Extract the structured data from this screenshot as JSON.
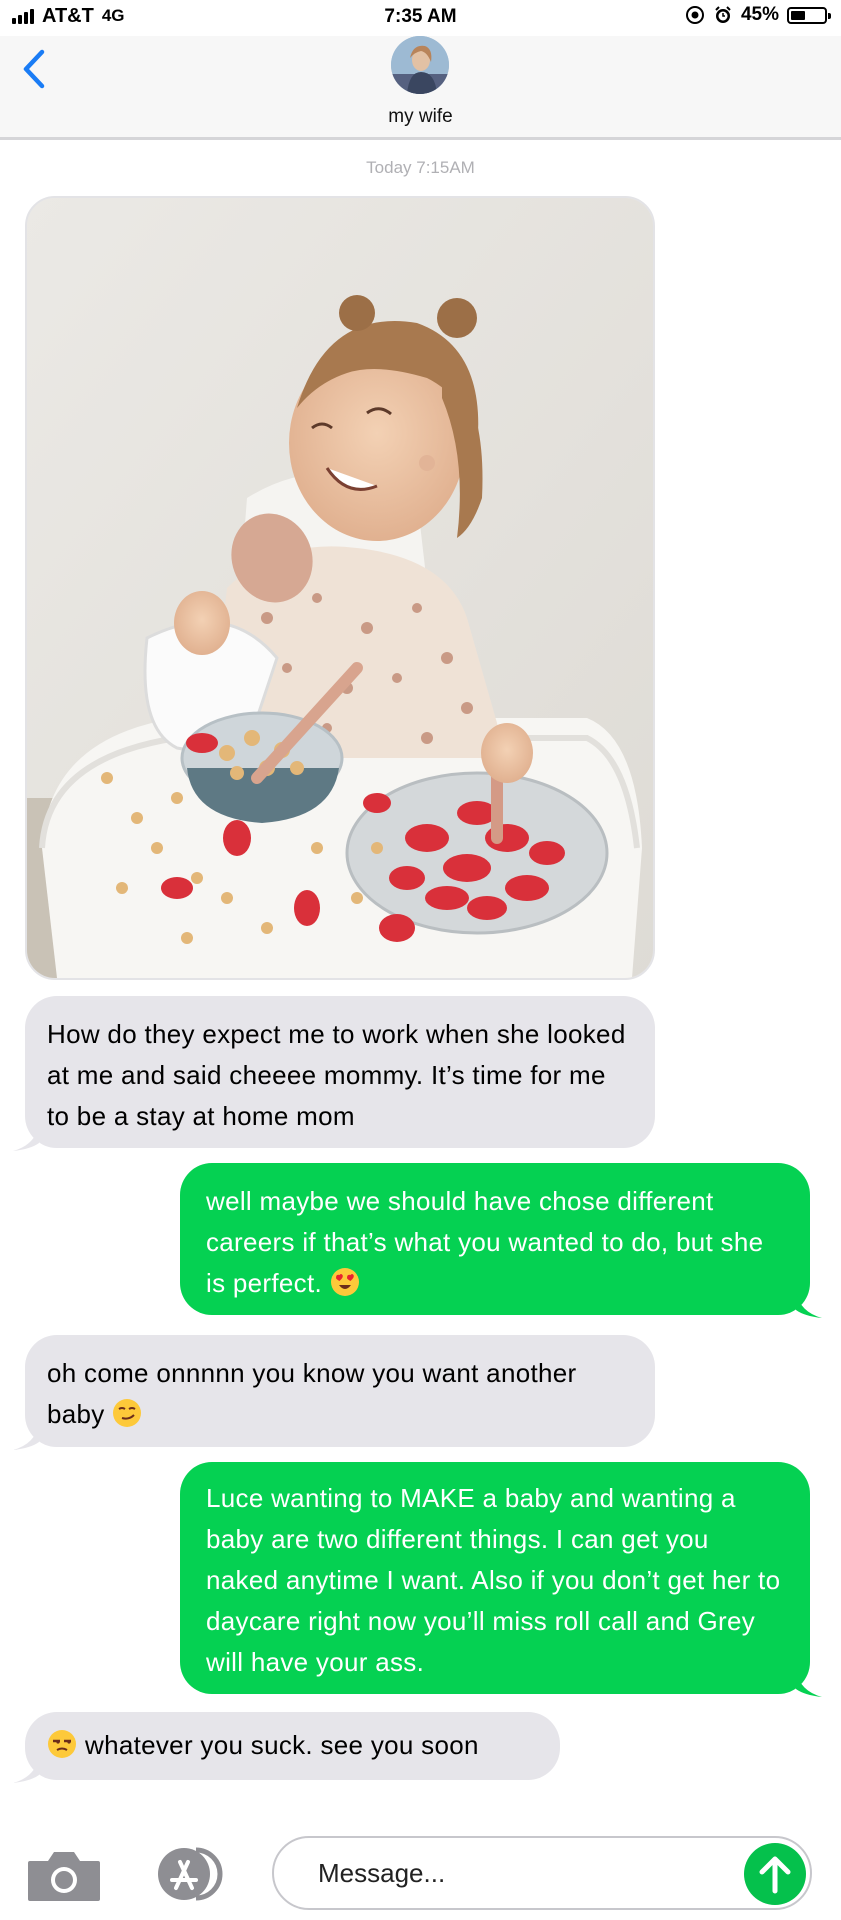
{
  "status_bar": {
    "carrier": "AT&T",
    "network": "4G",
    "time": "7:35 AM",
    "battery_percent": "45%",
    "battery_level": 0.45
  },
  "header": {
    "contact_name": "my wife"
  },
  "conversation": {
    "timestamp": "Today 7:15AM",
    "messages": [
      {
        "from": "them",
        "text": "How do they expect me to work when she looked at me and said cheeee mommy. It’s time for me to be a stay at home mom"
      },
      {
        "from": "me",
        "text": "well maybe we should have chose different careers if that’s what you wanted to do, but she is perfect.",
        "emoji": "heart-eyes-emoji"
      },
      {
        "from": "them",
        "text": "oh come onnnnn you know you want another baby",
        "emoji": "smirk-emoji"
      },
      {
        "from": "me",
        "text": "Luce wanting to MAKE a baby and wanting a baby are two different things. I can get you naked anytime I want. Also if you don’t get her to daycare right now you’ll miss roll call and Grey will have your ass."
      },
      {
        "from": "them",
        "text": "whatever you suck. see you soon",
        "emoji": "unamused-emoji"
      }
    ]
  },
  "composer": {
    "placeholder": "Message..."
  },
  "colors": {
    "ios_blue": "#1a7cf5",
    "sent_bubble": "#05d152",
    "received_bubble": "#e6e5ea",
    "send_button": "#05c14c"
  }
}
